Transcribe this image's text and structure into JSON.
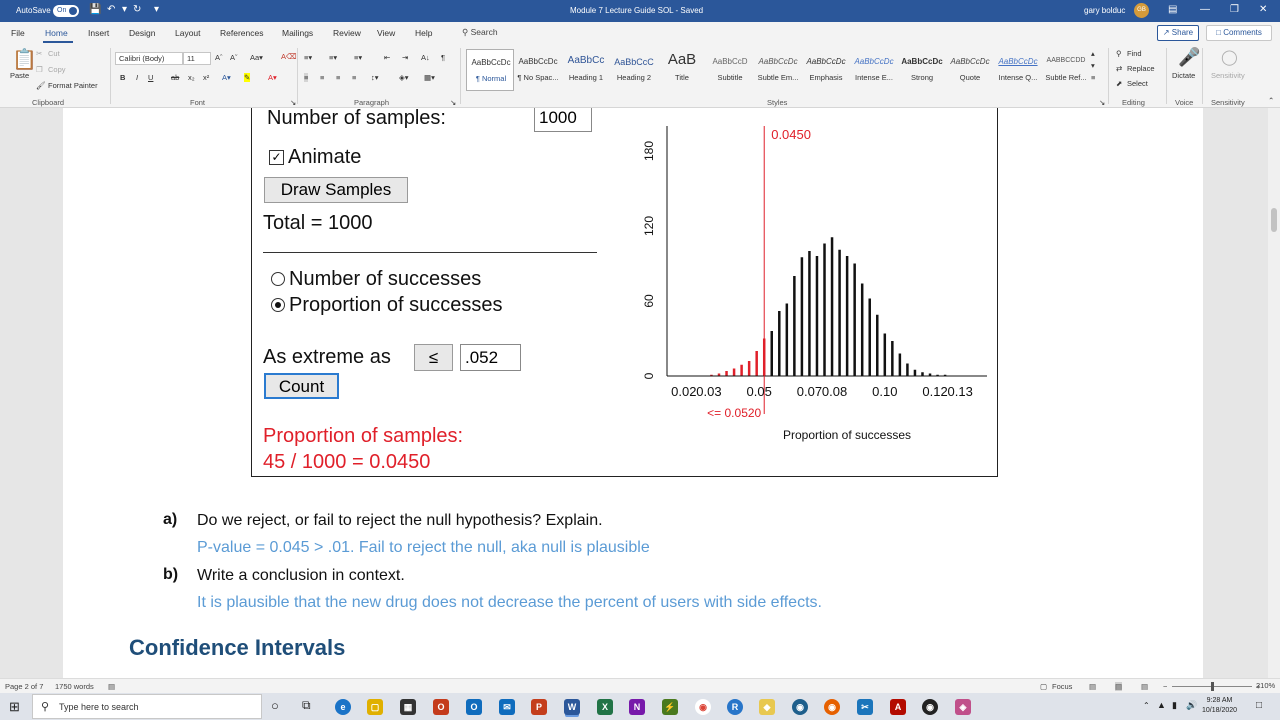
{
  "titlebar": {
    "autosave_label": "AutoSave",
    "autosave_state": "On",
    "doc_title": "Module 7 Lecture Guide SOL  -  Saved",
    "user_name": "gary bolduc",
    "user_initials": "GB"
  },
  "tabs": {
    "items": [
      "File",
      "Home",
      "Insert",
      "Design",
      "Layout",
      "References",
      "Mailings",
      "Review",
      "View",
      "Help"
    ],
    "search_label": "Search",
    "share_label": "Share",
    "comments_label": "Comments"
  },
  "ribbon": {
    "clipboard": {
      "paste": "Paste",
      "cut": "Cut",
      "copy": "Copy",
      "format_painter": "Format Painter",
      "label": "Clipboard"
    },
    "font": {
      "family": "Calibri (Body)",
      "size": "11",
      "label": "Font"
    },
    "paragraph": {
      "label": "Paragraph"
    },
    "styles": {
      "label": "Styles",
      "items": [
        {
          "preview": "AaBbCcDc",
          "name": "¶ Normal"
        },
        {
          "preview": "AaBbCcDc",
          "name": "¶ No Spac..."
        },
        {
          "preview": "AaBbCc",
          "name": "Heading 1"
        },
        {
          "preview": "AaBbCcC",
          "name": "Heading 2"
        },
        {
          "preview": "AaB",
          "name": "Title"
        },
        {
          "preview": "AaBbCcD",
          "name": "Subtitle"
        },
        {
          "preview": "AaBbCcDc",
          "name": "Subtle Em..."
        },
        {
          "preview": "AaBbCcDc",
          "name": "Emphasis"
        },
        {
          "preview": "AaBbCcDc",
          "name": "Intense E..."
        },
        {
          "preview": "AaBbCcDc",
          "name": "Strong"
        },
        {
          "preview": "AaBbCcDc",
          "name": "Quote"
        },
        {
          "preview": "AaBbCcDc",
          "name": "Intense Q..."
        },
        {
          "preview": "AABBCCDD",
          "name": "Subtle Ref..."
        }
      ]
    },
    "editing": {
      "find": "Find",
      "replace": "Replace",
      "select": "Select",
      "label": "Editing"
    },
    "voice": {
      "dictate": "Dictate",
      "label": "Voice"
    },
    "sensitivity": {
      "button": "Sensitivity",
      "label": "Sensitivity"
    }
  },
  "applet": {
    "num_samples_label": "Number of samples:",
    "num_samples_value": "1000",
    "animate_label": "Animate",
    "draw_button": "Draw Samples",
    "total_text": "Total = 1000",
    "radio_count_label": "Number of successes",
    "radio_prop_label": "Proportion of successes",
    "extreme_label": "As extreme as",
    "extreme_operator": "≤",
    "extreme_value": ".052",
    "count_button": "Count",
    "result_label": "Proportion of samples:",
    "result_value": "45 / 1000 = 0.0450"
  },
  "chart_data": {
    "type": "bar",
    "title": "",
    "xlabel": "Proportion of successes",
    "ylabel": "",
    "ylim": [
      0,
      200
    ],
    "yticks": [
      0,
      60,
      120,
      180
    ],
    "xticks": [
      "0.02",
      "0.03",
      "0.05",
      "0.07",
      "0.08",
      "0.10",
      "0.12",
      "0.13"
    ],
    "xtick_values": [
      0.02,
      0.03,
      0.05,
      0.07,
      0.08,
      0.1,
      0.12,
      0.13
    ],
    "xlim": [
      0.0133,
      0.1367
    ],
    "cutoff": 0.052,
    "cutoff_label": "<= 0.0520",
    "proportion_label": "0.0450",
    "colors": {
      "tail": "#e0202a",
      "bars": "#111111"
    },
    "x": [
      0.031,
      0.034,
      0.037,
      0.04,
      0.043,
      0.046,
      0.049,
      0.052,
      0.055,
      0.058,
      0.061,
      0.064,
      0.067,
      0.07,
      0.073,
      0.076,
      0.079,
      0.082,
      0.085,
      0.088,
      0.091,
      0.094,
      0.097,
      0.1,
      0.103,
      0.106,
      0.109,
      0.112,
      0.115,
      0.118,
      0.121,
      0.124
    ],
    "values": [
      1,
      2,
      4,
      6,
      9,
      12,
      20,
      30,
      36,
      52,
      58,
      80,
      95,
      100,
      96,
      106,
      111,
      101,
      96,
      90,
      74,
      62,
      49,
      34,
      28,
      18,
      10,
      5,
      3,
      2,
      1,
      1
    ]
  },
  "doc": {
    "qa_letter": "a)",
    "qa_text": "Do we reject, or fail to reject the null hypothesis?  Explain.",
    "qa_answer": "P-value = 0.045 > .01.  Fail to reject the null, aka null is plausible",
    "qb_letter": "b)",
    "qb_text": "Write a conclusion in context.",
    "qb_answer": "It is plausible that the new drug does not decrease the percent of users with side effects.",
    "heading": "Confidence Intervals"
  },
  "status": {
    "page": "Page 2 of 7",
    "words": "1750 words",
    "focus": "Focus",
    "zoom": "210%"
  },
  "taskbar": {
    "search_placeholder": "Type here to search",
    "time": "9:28 AM",
    "date": "10/18/2020"
  }
}
